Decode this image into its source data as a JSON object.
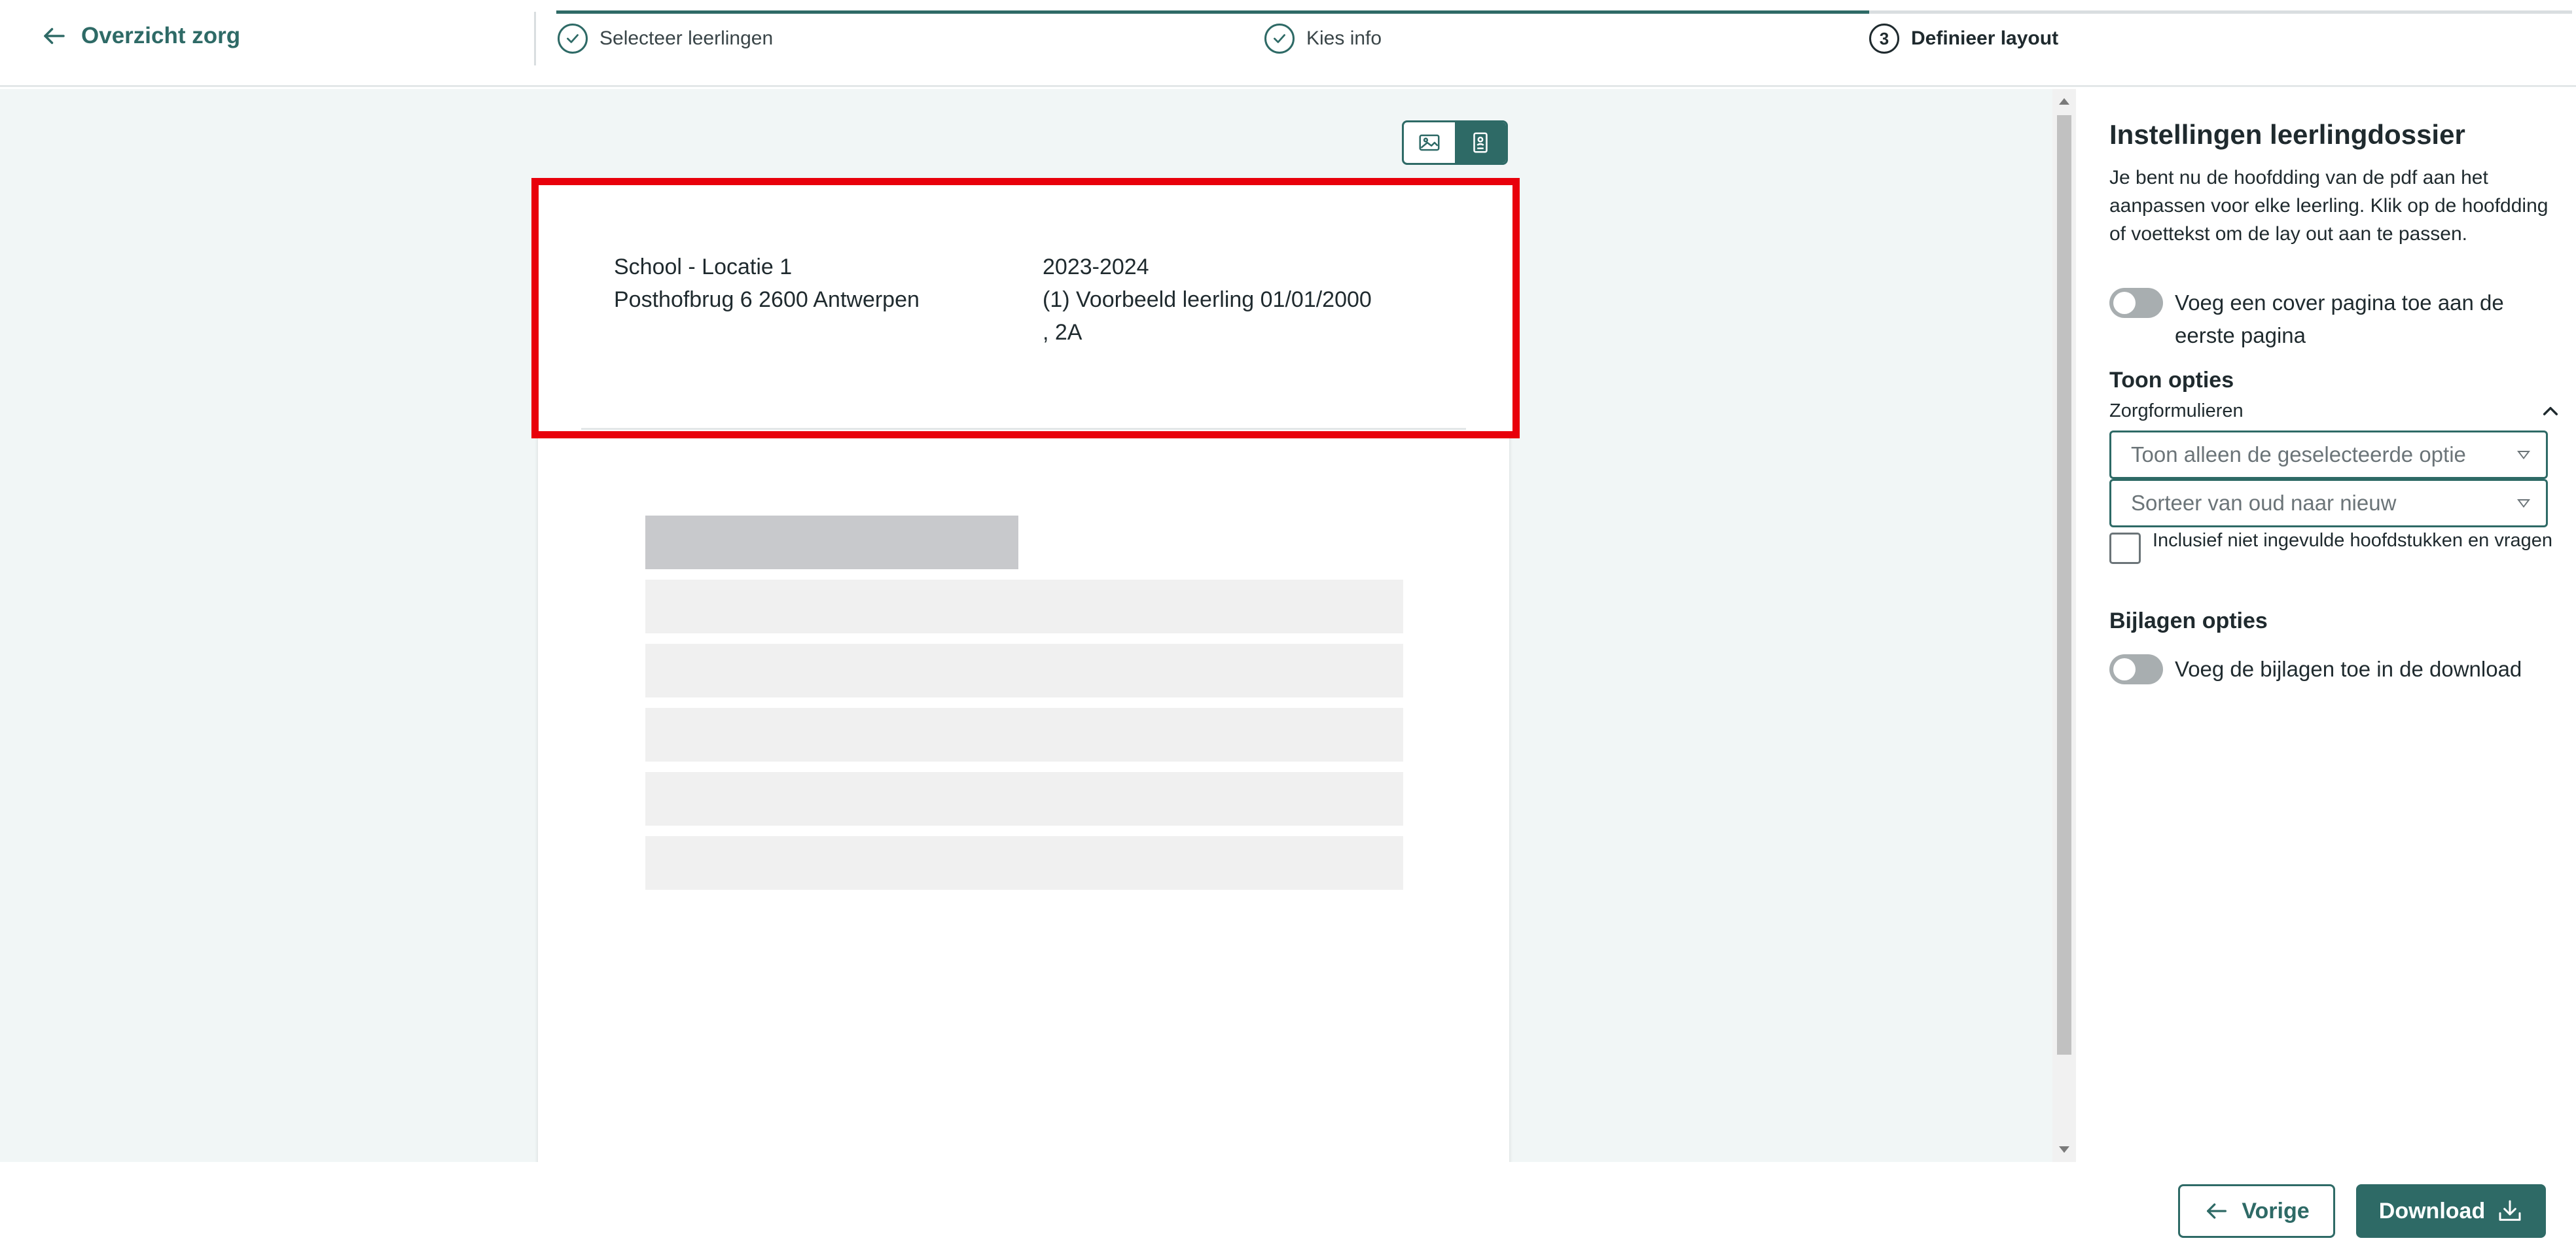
{
  "topbar": {
    "back_label": "Overzicht zorg",
    "steps": [
      {
        "label": "Selecteer leerlingen",
        "state": "done"
      },
      {
        "label": "Kies info",
        "state": "done"
      },
      {
        "number": "3",
        "label": "Definieer layout",
        "state": "active"
      }
    ]
  },
  "preview": {
    "view_options": [
      {
        "icon": "image-icon",
        "active": false
      },
      {
        "icon": "portrait-document-icon",
        "active": true
      }
    ],
    "header": {
      "school": "School - Locatie 1",
      "address": "Posthofbrug 6 2600 Antwerpen",
      "year": "2023-2024",
      "student_line1": "(1) Voorbeeld leerling 01/01/2000",
      "student_line2": ", 2A"
    }
  },
  "panel": {
    "title": "Instellingen leerlingdossier",
    "description": "Je bent nu de hoofdding van de pdf aan het aanpassen voor elke leerling. Klik op de hoofdding of voettekst om de lay out aan te passen.",
    "cover_toggle_label": "Voeg een cover pagina toe aan de eerste pagina",
    "show_options_title": "Toon opties",
    "care_forms_label": "Zorgformulieren",
    "select_filter": "Toon alleen de geselecteerde optie",
    "select_sort": "Sorteer van oud naar nieuw",
    "include_empty_label": "Inclusief niet ingevulde hoofdstukken en vragen",
    "attachments_title": "Bijlagen opties",
    "attachments_toggle_label": "Voeg de bijlagen toe in de download"
  },
  "footer": {
    "prev_label": "Vorige",
    "download_label": "Download"
  },
  "colors": {
    "accent": "#2e6a66",
    "highlight": "#e8000b",
    "background": "#f1f6f6"
  }
}
